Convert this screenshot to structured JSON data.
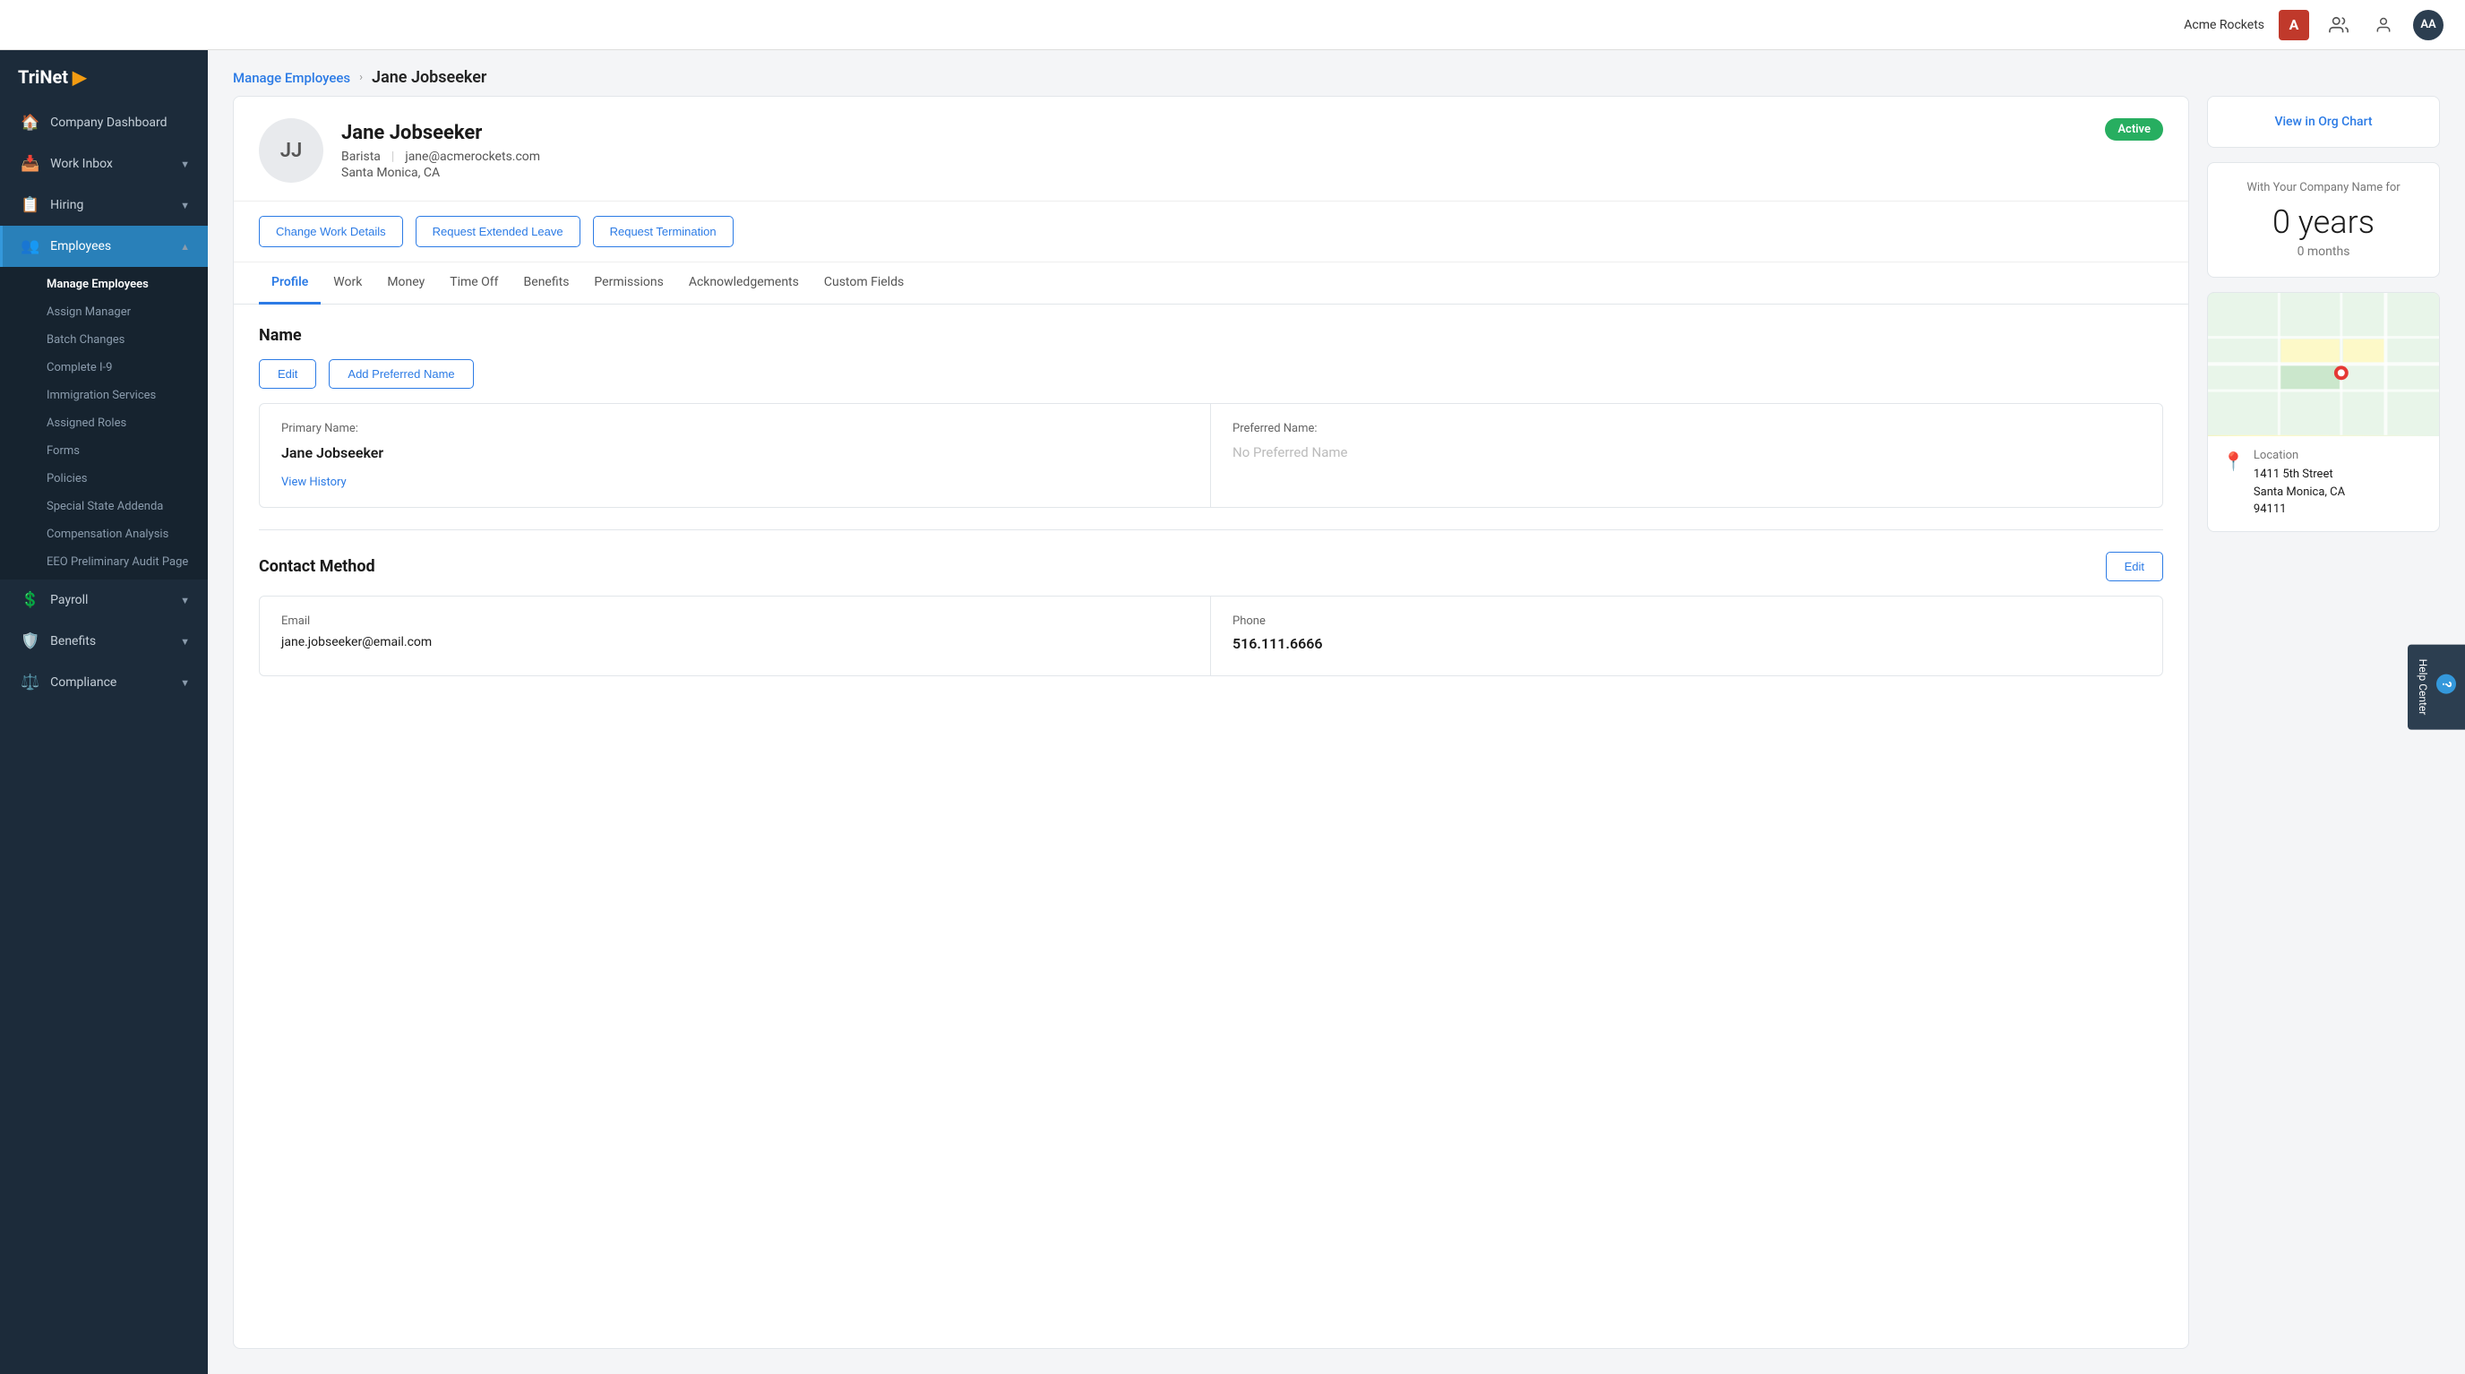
{
  "header": {
    "company_name": "Acme Rockets",
    "company_logo_letter": "A",
    "avatar_initials": "AA"
  },
  "sidebar": {
    "logo": "TriNet",
    "nav_items": [
      {
        "id": "company-dashboard",
        "label": "Company Dashboard",
        "icon": "🏠",
        "active": false,
        "expandable": false
      },
      {
        "id": "work-inbox",
        "label": "Work Inbox",
        "icon": "📥",
        "active": false,
        "expandable": true
      },
      {
        "id": "hiring",
        "label": "Hiring",
        "icon": "📋",
        "active": false,
        "expandable": true
      },
      {
        "id": "employees",
        "label": "Employees",
        "icon": "👥",
        "active": true,
        "expandable": true
      },
      {
        "id": "payroll",
        "label": "Payroll",
        "icon": "💲",
        "active": false,
        "expandable": true
      },
      {
        "id": "benefits",
        "label": "Benefits",
        "icon": "🛡️",
        "active": false,
        "expandable": true
      },
      {
        "id": "compliance",
        "label": "Compliance",
        "icon": "⚖️",
        "active": false,
        "expandable": true
      }
    ],
    "submenu": [
      {
        "id": "manage-employees",
        "label": "Manage Employees",
        "active": true
      },
      {
        "id": "assign-manager",
        "label": "Assign Manager",
        "active": false
      },
      {
        "id": "batch-changes",
        "label": "Batch Changes",
        "active": false
      },
      {
        "id": "complete-i9",
        "label": "Complete I-9",
        "active": false
      },
      {
        "id": "immigration-services",
        "label": "Immigration Services",
        "active": false
      },
      {
        "id": "assigned-roles",
        "label": "Assigned Roles",
        "active": false
      },
      {
        "id": "forms",
        "label": "Forms",
        "active": false
      },
      {
        "id": "policies",
        "label": "Policies",
        "active": false
      },
      {
        "id": "special-state-addenda",
        "label": "Special State Addenda",
        "active": false
      },
      {
        "id": "compensation-analysis",
        "label": "Compensation Analysis",
        "active": false
      },
      {
        "id": "eeo-audit",
        "label": "EEO Preliminary Audit Page",
        "active": false
      }
    ]
  },
  "breadcrumb": {
    "parent": "Manage Employees",
    "separator": "›",
    "current": "Jane Jobseeker"
  },
  "employee": {
    "initials": "JJ",
    "name": "Jane Jobseeker",
    "title": "Barista",
    "email": "jane@acmerockets.com",
    "location": "Santa Monica, CA",
    "status": "Active"
  },
  "action_buttons": [
    {
      "id": "change-work-details",
      "label": "Change Work Details"
    },
    {
      "id": "request-extended-leave",
      "label": "Request Extended Leave"
    },
    {
      "id": "request-termination",
      "label": "Request Termination"
    }
  ],
  "tabs": [
    {
      "id": "profile",
      "label": "Profile",
      "active": true
    },
    {
      "id": "work",
      "label": "Work",
      "active": false
    },
    {
      "id": "money",
      "label": "Money",
      "active": false
    },
    {
      "id": "time-off",
      "label": "Time Off",
      "active": false
    },
    {
      "id": "benefits",
      "label": "Benefits",
      "active": false
    },
    {
      "id": "permissions",
      "label": "Permissions",
      "active": false
    },
    {
      "id": "acknowledgements",
      "label": "Acknowledgements",
      "active": false
    },
    {
      "id": "custom-fields",
      "label": "Custom Fields",
      "active": false
    }
  ],
  "profile": {
    "name_section": {
      "title": "Name",
      "edit_button": "Edit",
      "add_preferred_button": "Add Preferred Name",
      "primary_label": "Primary Name:",
      "primary_value": "Jane Jobseeker",
      "preferred_label": "Preferred Name:",
      "preferred_placeholder": "No Preferred Name",
      "view_history": "View History"
    },
    "contact_section": {
      "title": "Contact Method",
      "edit_button": "Edit",
      "email_label": "Email",
      "email_value": "jane.jobseeker@email.com",
      "phone_label": "Phone",
      "phone_value": "516.111.6666"
    }
  },
  "right_panel": {
    "org_chart_link": "View in Org Chart",
    "tenure": {
      "label": "With Your Company Name for",
      "years": "0 years",
      "months": "0 months"
    },
    "location": {
      "heading": "Location",
      "address_line1": "1411 5th Street",
      "address_line2": "Santa Monica, CA",
      "address_line3": "94111"
    }
  },
  "help": {
    "question_mark": "?",
    "label": "Help Center"
  }
}
